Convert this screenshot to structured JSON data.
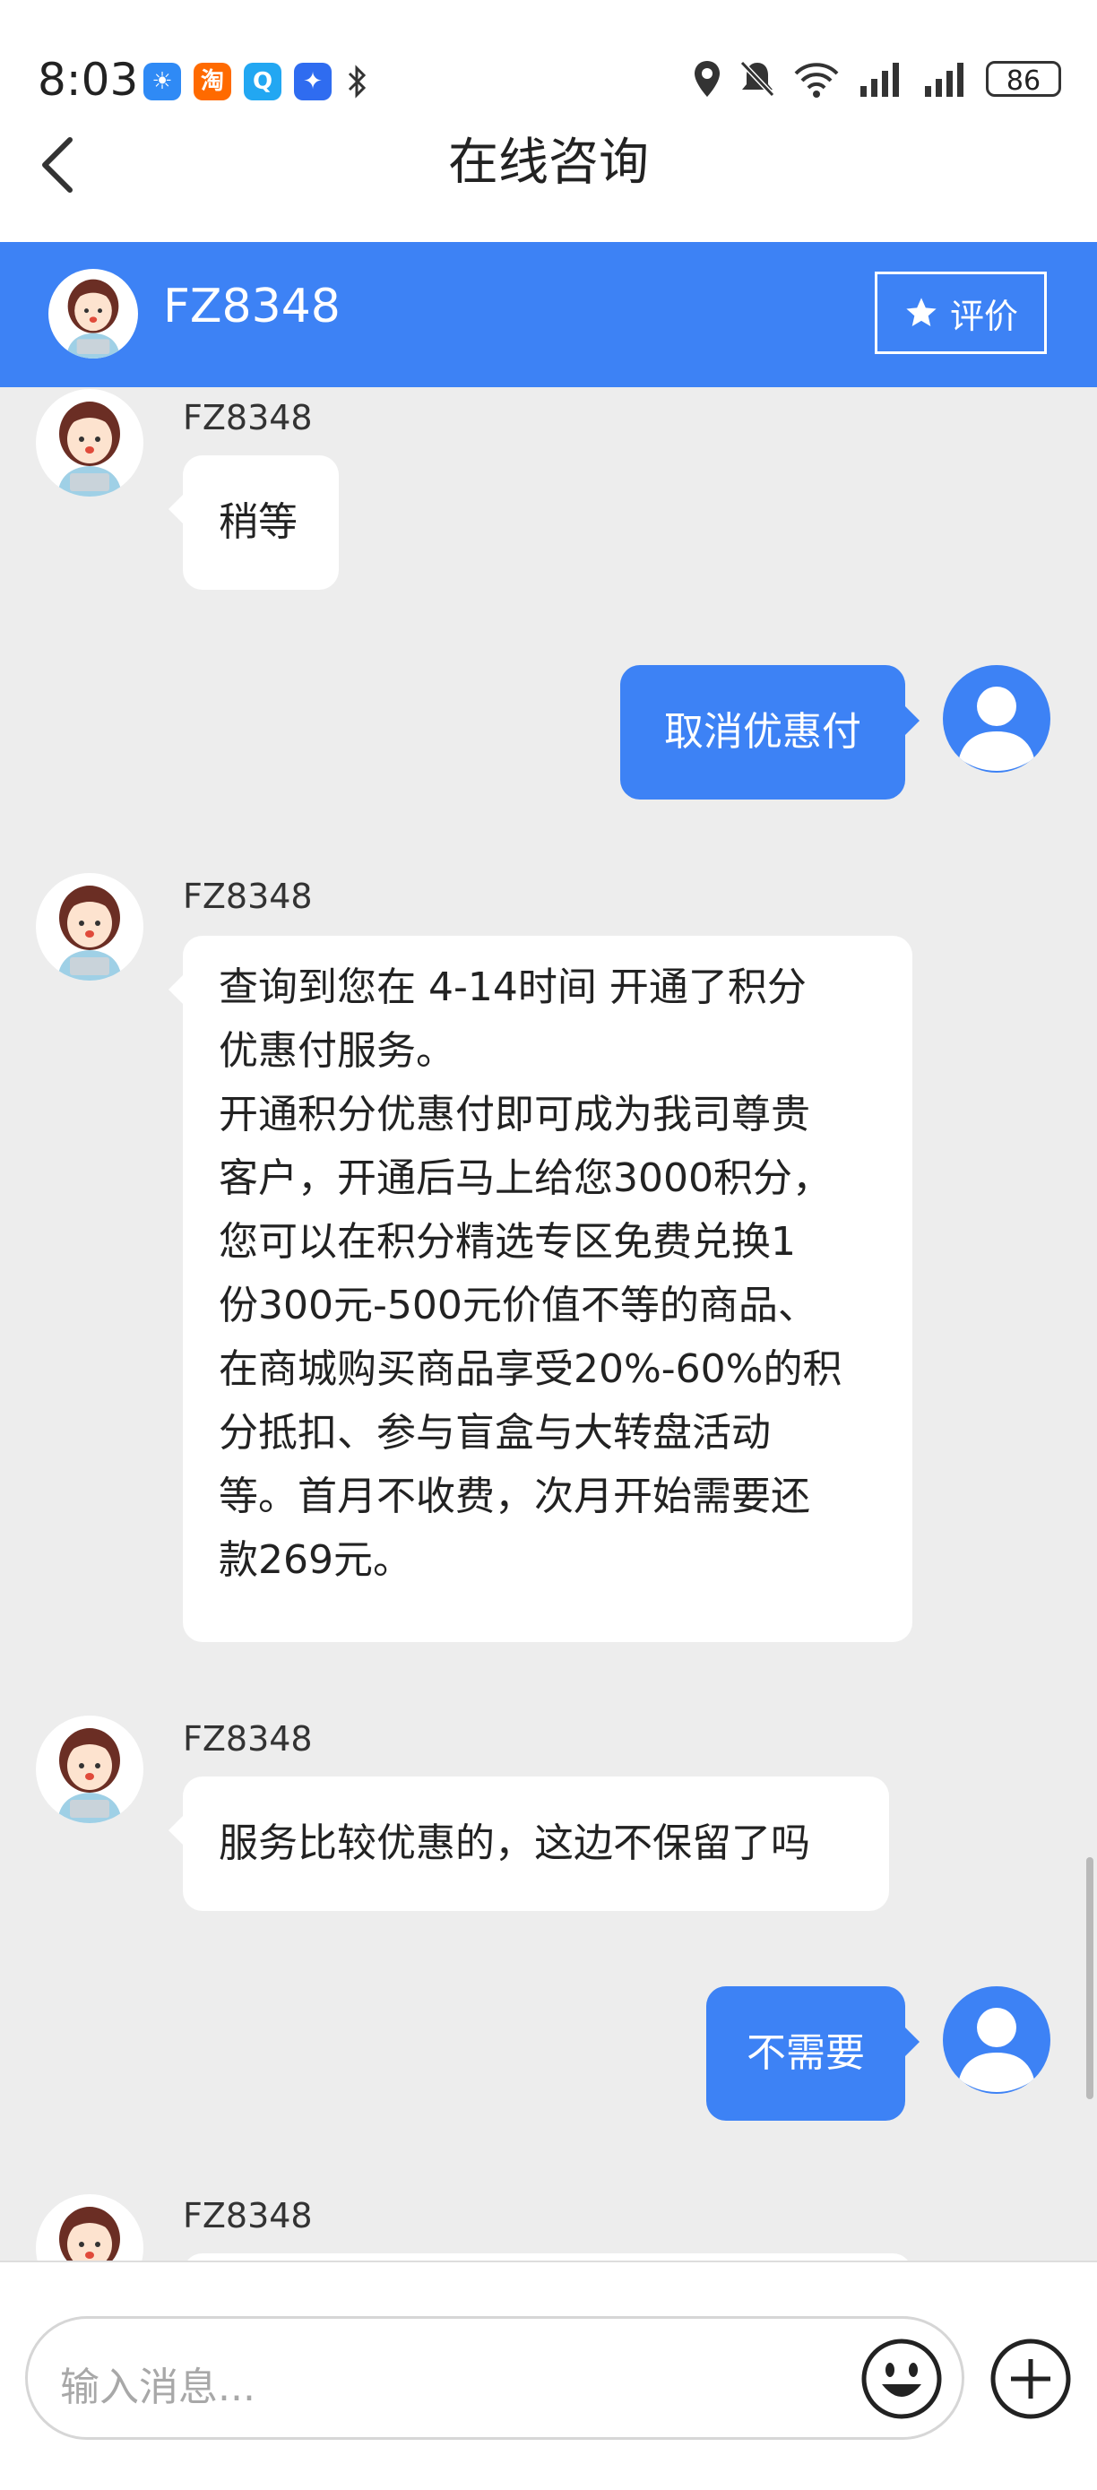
{
  "status_bar": {
    "time": "8:03",
    "battery": "86",
    "apps": [
      {
        "name": "weather-app-icon",
        "color": "#2f8af5",
        "glyph": "☀"
      },
      {
        "name": "taobao-app-icon",
        "color": "#ff6a00",
        "glyph": "淘"
      },
      {
        "name": "search-app-icon",
        "color": "#22a7f2",
        "glyph": "Q"
      },
      {
        "name": "bulb-app-icon",
        "color": "#2f6cf0",
        "glyph": "✦"
      }
    ]
  },
  "header": {
    "title": "在线咨询"
  },
  "agent": {
    "name": "FZ8348",
    "rate_label": "评价"
  },
  "messages": [
    {
      "side": "left",
      "sender": "FZ8348",
      "text": "稍等"
    },
    {
      "side": "right",
      "text": "取消优惠付"
    },
    {
      "side": "left",
      "sender": "FZ8348",
      "lines": [
        "查询到您在 4-14时间 开通了积分",
        "优惠付服务。",
        "开通积分优惠付即可成为我司尊贵",
        "客户，开通后马上给您3000积分，",
        "您可以在积分精选专区免费兑换1",
        "份300元-500元价值不等的商品、",
        "在商城购买商品享受20%-60%的积",
        "分抵扣、参与盲盒与大转盘活动",
        "等。首月不收费，次月开始需要还",
        "款269元。"
      ]
    },
    {
      "side": "left",
      "sender": "FZ8348",
      "text": "服务比较优惠的，这边不保留了吗"
    },
    {
      "side": "right",
      "text": "不需要"
    },
    {
      "side": "left",
      "sender": "FZ8348",
      "text": ""
    }
  ],
  "input": {
    "placeholder": "输入消息..."
  },
  "colors": {
    "accent": "#3d82f5",
    "background": "#ededed"
  }
}
